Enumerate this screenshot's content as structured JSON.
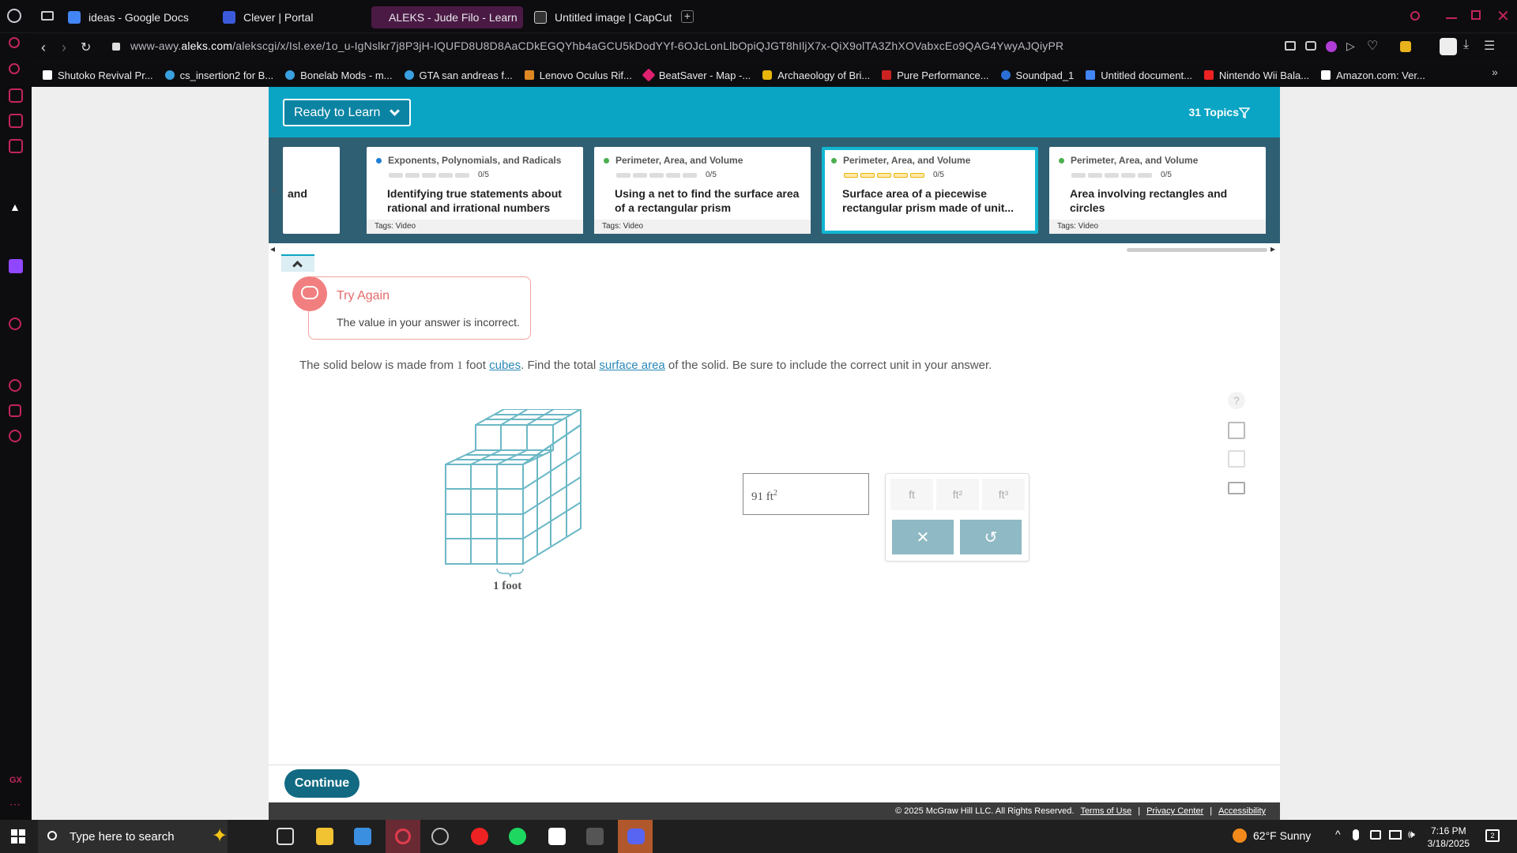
{
  "browser": {
    "tabs": [
      {
        "label": "ideas - Google Docs",
        "color": "#4285f4"
      },
      {
        "label": "Clever | Portal",
        "color": "#3b5bdb"
      },
      {
        "label": "ALEKS - Jude Filo - Learn",
        "color": "#2c3e99"
      },
      {
        "label": "Untitled image | CapCut",
        "color": "#222222"
      }
    ],
    "url_prefix": "www-awy.",
    "url_domain": "aleks.com",
    "url_rest": "/alekscgi/x/Isl.exe/1o_u-IgNslkr7j8P3jH-IQUFD8U8D8AaCDkEGQYhb4aGCU5kDodYYf-6OJcLonLlbOpiQJGT8hIljX7x-QiX9olTA3ZhXOVabxcEo9QAG4YwyAJQiyPR",
    "bookmarks": [
      "Shutoko Revival Pr...",
      "cs_insertion2 for B...",
      "Bonelab Mods - m...",
      "GTA san andreas f...",
      "Lenovo Oculus Rif...",
      "BeatSaver - Map -...",
      "Archaeology of Bri...",
      "Pure Performance...",
      "Soundpad_1",
      "Untitled document...",
      "Nintendo Wii Bala...",
      "Amazon.com: Ver..."
    ]
  },
  "header": {
    "dropdown_label": "Ready to Learn",
    "topics_count": "31 Topics"
  },
  "carousel": {
    "partial_card_text": "and",
    "cards": [
      {
        "category": "Exponents, Polynomials, and Radicals",
        "progress": "0/5",
        "progress_fraction": 0,
        "title": "Identifying true statements about rational and irrational numbers",
        "tags": "Tags: Video",
        "dot_color": "#1e7ed6"
      },
      {
        "category": "Perimeter, Area, and Volume",
        "progress": "0/5",
        "progress_fraction": 0,
        "title": "Using a net to find the surface area of a rectangular prism",
        "tags": "Tags: Video",
        "dot_color": "#4caf50"
      },
      {
        "category": "Perimeter, Area, and Volume",
        "progress": "0/5",
        "progress_fraction": 0,
        "title": "Surface area of a piecewise rectangular prism made of unit...",
        "tags": "",
        "dot_color": "#4caf50",
        "selected": true
      },
      {
        "category": "Perimeter, Area, and Volume",
        "progress": "0/5",
        "progress_fraction": 0,
        "title": "Area involving rectangles and circles",
        "tags": "Tags: Video",
        "dot_color": "#4caf50"
      }
    ]
  },
  "feedback": {
    "title": "Try Again",
    "message": "The value in your answer is incorrect."
  },
  "question": {
    "part1": "The solid below is made from ",
    "num": "1",
    "part2": " foot ",
    "link1": "cubes",
    "part3": ". Find the total ",
    "link2": "surface area",
    "part4": " of the solid. Be sure to include the correct unit in your answer."
  },
  "figure": {
    "label": "1 foot"
  },
  "answer": {
    "value": "91 ft",
    "exponent": "2"
  },
  "units": {
    "ft": "ft",
    "ft2": "ft²",
    "ft3": "ft³",
    "clear": "✕",
    "undo": "↺"
  },
  "footer": {
    "continue": "Continue",
    "copyright": "© 2025 McGraw Hill LLC. All Rights Reserved.",
    "terms": "Terms of Use",
    "privacy": "Privacy Center",
    "accessibility": "Accessibility",
    "sep": "|"
  },
  "taskbar": {
    "search_placeholder": "Type here to search",
    "weather": "62°F  Sunny",
    "time": "7:16 PM",
    "date": "3/18/2025",
    "notif_count": "2"
  },
  "colors": {
    "accent": "#0aa5c4",
    "strip": "#2f5f73",
    "error": "#e36b6b",
    "continue": "#116a82"
  }
}
